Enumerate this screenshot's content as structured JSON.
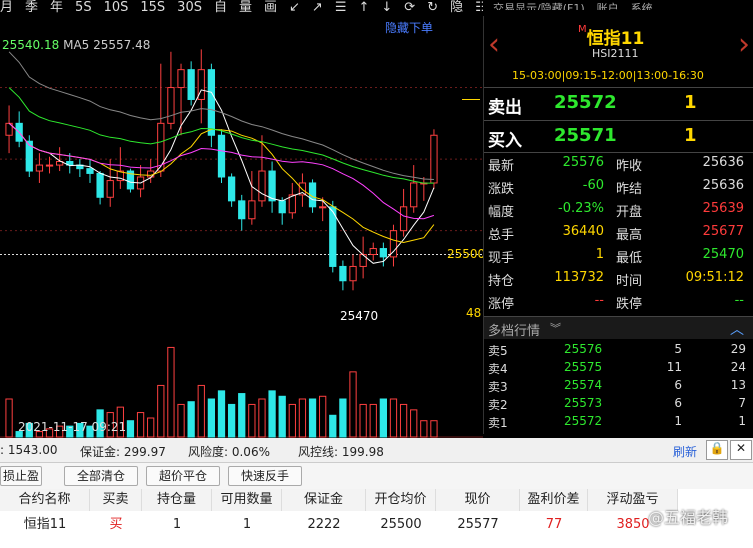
{
  "toolbar": {
    "items": [
      "月",
      "季",
      "年",
      "5S",
      "10S",
      "15S",
      "30S",
      "自",
      "量",
      "画",
      "↙",
      "↗",
      "☰",
      "↑",
      "↓",
      "⟳",
      "↻",
      "隐",
      "☷",
      "⊟",
      "▾"
    ],
    "right_items": [
      "交易显示/隐藏(F1)",
      "账户",
      "系统"
    ]
  },
  "chart": {
    "hide_order_label": "隐藏下单",
    "ma_close": "25540.18",
    "ma5_label": "MA5 25557.48",
    "price_label_main": "25500",
    "price_label_low": "25470",
    "price_label_48": "48",
    "date_time": "2021-11-17 09:21"
  },
  "chart_data": {
    "type": "candlestick",
    "title": "",
    "xlabel": "",
    "ylabel": "",
    "ylim": [
      25430,
      25700
    ],
    "annotations": [
      "25500",
      "25470"
    ],
    "candles": [
      {
        "o": 25600,
        "c": 25610,
        "h": 25625,
        "l": 25585
      },
      {
        "o": 25610,
        "c": 25595,
        "h": 25620,
        "l": 25590
      },
      {
        "o": 25595,
        "c": 25570,
        "h": 25600,
        "l": 25565
      },
      {
        "o": 25570,
        "c": 25575,
        "h": 25585,
        "l": 25560
      },
      {
        "o": 25575,
        "c": 25575,
        "h": 25582,
        "l": 25568
      },
      {
        "o": 25575,
        "c": 25578,
        "h": 25590,
        "l": 25570
      },
      {
        "o": 25578,
        "c": 25575,
        "h": 25585,
        "l": 25568
      },
      {
        "o": 25575,
        "c": 25572,
        "h": 25580,
        "l": 25565
      },
      {
        "o": 25572,
        "c": 25568,
        "h": 25580,
        "l": 25560
      },
      {
        "o": 25568,
        "c": 25548,
        "h": 25570,
        "l": 25542
      },
      {
        "o": 25548,
        "c": 25562,
        "h": 25580,
        "l": 25540
      },
      {
        "o": 25562,
        "c": 25570,
        "h": 25590,
        "l": 25555
      },
      {
        "o": 25570,
        "c": 25555,
        "h": 25572,
        "l": 25552
      },
      {
        "o": 25555,
        "c": 25565,
        "h": 25575,
        "l": 25548
      },
      {
        "o": 25565,
        "c": 25570,
        "h": 25580,
        "l": 25560
      },
      {
        "o": 25570,
        "c": 25610,
        "h": 25660,
        "l": 25565
      },
      {
        "o": 25610,
        "c": 25640,
        "h": 25670,
        "l": 25605
      },
      {
        "o": 25640,
        "c": 25655,
        "h": 25660,
        "l": 25600
      },
      {
        "o": 25655,
        "c": 25630,
        "h": 25662,
        "l": 25625
      },
      {
        "o": 25630,
        "c": 25655,
        "h": 25672,
        "l": 25610
      },
      {
        "o": 25655,
        "c": 25600,
        "h": 25660,
        "l": 25590
      },
      {
        "o": 25600,
        "c": 25565,
        "h": 25605,
        "l": 25560
      },
      {
        "o": 25565,
        "c": 25545,
        "h": 25568,
        "l": 25540
      },
      {
        "o": 25545,
        "c": 25530,
        "h": 25550,
        "l": 25520
      },
      {
        "o": 25530,
        "c": 25545,
        "h": 25570,
        "l": 25525
      },
      {
        "o": 25545,
        "c": 25570,
        "h": 25600,
        "l": 25540
      },
      {
        "o": 25570,
        "c": 25545,
        "h": 25578,
        "l": 25535
      },
      {
        "o": 25545,
        "c": 25535,
        "h": 25548,
        "l": 25525
      },
      {
        "o": 25535,
        "c": 25550,
        "h": 25560,
        "l": 25530
      },
      {
        "o": 25550,
        "c": 25560,
        "h": 25568,
        "l": 25540
      },
      {
        "o": 25560,
        "c": 25540,
        "h": 25563,
        "l": 25535
      },
      {
        "o": 25540,
        "c": 25540,
        "h": 25548,
        "l": 25528
      },
      {
        "o": 25540,
        "c": 25490,
        "h": 25545,
        "l": 25485
      },
      {
        "o": 25490,
        "c": 25478,
        "h": 25495,
        "l": 25470
      },
      {
        "o": 25478,
        "c": 25490,
        "h": 25500,
        "l": 25470
      },
      {
        "o": 25490,
        "c": 25500,
        "h": 25515,
        "l": 25480
      },
      {
        "o": 25500,
        "c": 25505,
        "h": 25510,
        "l": 25495
      },
      {
        "o": 25505,
        "c": 25498,
        "h": 25510,
        "l": 25490
      },
      {
        "o": 25498,
        "c": 25520,
        "h": 25525,
        "l": 25490
      },
      {
        "o": 25520,
        "c": 25540,
        "h": 25555,
        "l": 25515
      },
      {
        "o": 25540,
        "c": 25560,
        "h": 25575,
        "l": 25535
      },
      {
        "o": 25560,
        "c": 25560,
        "h": 25565,
        "l": 25545
      },
      {
        "o": 25560,
        "c": 25600,
        "h": 25605,
        "l": 25555
      }
    ],
    "volume": [
      14,
      2,
      5,
      2,
      3,
      4,
      4,
      5,
      4,
      10,
      9,
      11,
      6,
      9,
      7,
      19,
      33,
      12,
      13,
      19,
      14,
      17,
      12,
      16,
      12,
      14,
      17,
      15,
      12,
      14,
      14,
      15,
      8,
      14,
      24,
      12,
      12,
      14,
      14,
      12,
      10,
      6,
      6
    ]
  },
  "quote": {
    "symbol_prefix": "M",
    "symbol": "恒指11",
    "code": "HSI2111",
    "session": "15-03:00|09:15-12:00|13:00-16:30",
    "sell_label": "卖出",
    "sell_price": "25572",
    "sell_qty": "1",
    "buy_label": "买入",
    "buy_price": "25571",
    "buy_qty": "1",
    "stats": [
      {
        "l": "最新",
        "v": "25576",
        "vc": "g",
        "l2": "昨收",
        "v2": "25636",
        "v2c": "w"
      },
      {
        "l": "涨跌",
        "v": "-60",
        "vc": "g",
        "l2": "昨结",
        "v2": "25636",
        "v2c": "w"
      },
      {
        "l": "幅度",
        "v": "-0.23%",
        "vc": "g",
        "l2": "开盘",
        "v2": "25639",
        "v2c": "r"
      },
      {
        "l": "总手",
        "v": "36440",
        "vc": "y",
        "l2": "最高",
        "v2": "25677",
        "v2c": "r"
      },
      {
        "l": "现手",
        "v": "1",
        "vc": "y",
        "l2": "最低",
        "v2": "25470",
        "v2c": "g"
      },
      {
        "l": "持仓",
        "v": "113732",
        "vc": "y",
        "l2": "时间",
        "v2": "09:51:12",
        "v2c": "y"
      },
      {
        "l": "涨停",
        "v": "--",
        "vc": "r",
        "l2": "跌停",
        "v2": "--",
        "v2c": "g"
      }
    ],
    "depth_title": "多档行情",
    "depth": [
      {
        "l": "卖5",
        "p": "25576",
        "q1": "5",
        "q2": "29"
      },
      {
        "l": "卖4",
        "p": "25575",
        "q1": "11",
        "q2": "24"
      },
      {
        "l": "卖3",
        "p": "25574",
        "q1": "6",
        "q2": "13"
      },
      {
        "l": "卖2",
        "p": "25573",
        "q1": "6",
        "q2": "7"
      },
      {
        "l": "卖1",
        "p": "25572",
        "q1": "1",
        "q2": "1"
      }
    ]
  },
  "account": {
    "equity": ": 1543.00",
    "margin": "保证金: 299.97",
    "risk": "风险度: 0.06%",
    "riskline": "风控线: 199.98",
    "refresh": "刷新"
  },
  "buttons": {
    "stop": "损止盈",
    "close_all": "全部清仓",
    "close_over": "超价平仓",
    "reverse": "快速反手"
  },
  "table": {
    "headers": [
      "合约名称",
      "买卖",
      "持仓量",
      "可用数量",
      "保证金",
      "开仓均价",
      "现价",
      "盈利价差",
      "浮动盈亏"
    ],
    "row": [
      "恒指11",
      "买",
      "1",
      "1",
      "2222",
      "25500",
      "25577",
      "77",
      "3850"
    ]
  },
  "watermark": "@五福老韩"
}
